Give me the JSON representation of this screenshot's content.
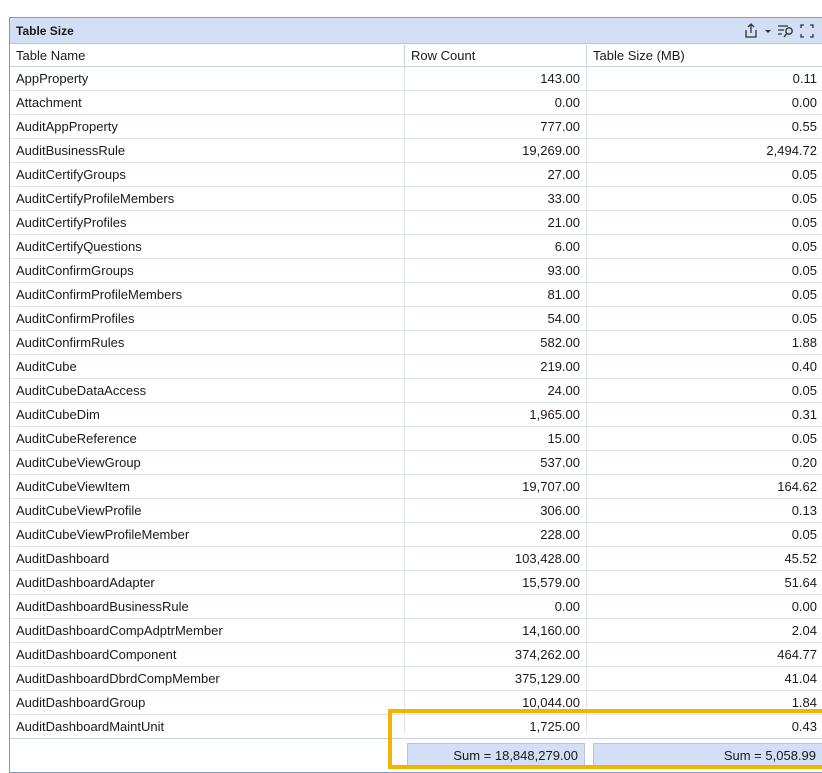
{
  "panel": {
    "title": "Table Size"
  },
  "toolbar": {
    "export_icon": "export-icon",
    "dropdown_icon": "chevron-down-icon",
    "filter_icon": "filter-search-icon",
    "fullscreen_icon": "fullscreen-icon"
  },
  "columns": [
    "Table Name",
    "Row Count",
    "Table Size (MB)"
  ],
  "rows": [
    [
      "AppProperty",
      "143.00",
      "0.11"
    ],
    [
      "Attachment",
      "0.00",
      "0.00"
    ],
    [
      "AuditAppProperty",
      "777.00",
      "0.55"
    ],
    [
      "AuditBusinessRule",
      "19,269.00",
      "2,494.72"
    ],
    [
      "AuditCertifyGroups",
      "27.00",
      "0.05"
    ],
    [
      "AuditCertifyProfileMembers",
      "33.00",
      "0.05"
    ],
    [
      "AuditCertifyProfiles",
      "21.00",
      "0.05"
    ],
    [
      "AuditCertifyQuestions",
      "6.00",
      "0.05"
    ],
    [
      "AuditConfirmGroups",
      "93.00",
      "0.05"
    ],
    [
      "AuditConfirmProfileMembers",
      "81.00",
      "0.05"
    ],
    [
      "AuditConfirmProfiles",
      "54.00",
      "0.05"
    ],
    [
      "AuditConfirmRules",
      "582.00",
      "1.88"
    ],
    [
      "AuditCube",
      "219.00",
      "0.40"
    ],
    [
      "AuditCubeDataAccess",
      "24.00",
      "0.05"
    ],
    [
      "AuditCubeDim",
      "1,965.00",
      "0.31"
    ],
    [
      "AuditCubeReference",
      "15.00",
      "0.05"
    ],
    [
      "AuditCubeViewGroup",
      "537.00",
      "0.20"
    ],
    [
      "AuditCubeViewItem",
      "19,707.00",
      "164.62"
    ],
    [
      "AuditCubeViewProfile",
      "306.00",
      "0.13"
    ],
    [
      "AuditCubeViewProfileMember",
      "228.00",
      "0.05"
    ],
    [
      "AuditDashboard",
      "103,428.00",
      "45.52"
    ],
    [
      "AuditDashboardAdapter",
      "15,579.00",
      "51.64"
    ],
    [
      "AuditDashboardBusinessRule",
      "0.00",
      "0.00"
    ],
    [
      "AuditDashboardCompAdptrMember",
      "14,160.00",
      "2.04"
    ],
    [
      "AuditDashboardComponent",
      "374,262.00",
      "464.77"
    ],
    [
      "AuditDashboardDbrdCompMember",
      "375,129.00",
      "41.04"
    ],
    [
      "AuditDashboardGroup",
      "10,044.00",
      "1.84"
    ],
    [
      "AuditDashboardMaintUnit",
      "1,725.00",
      "0.43"
    ]
  ],
  "footer": {
    "row_count_sum": "Sum = 18,848,279.00",
    "table_size_sum": "Sum = 5,058.99"
  },
  "colors": {
    "header_bg": "#d3dff4",
    "highlight": "#f5b300"
  }
}
